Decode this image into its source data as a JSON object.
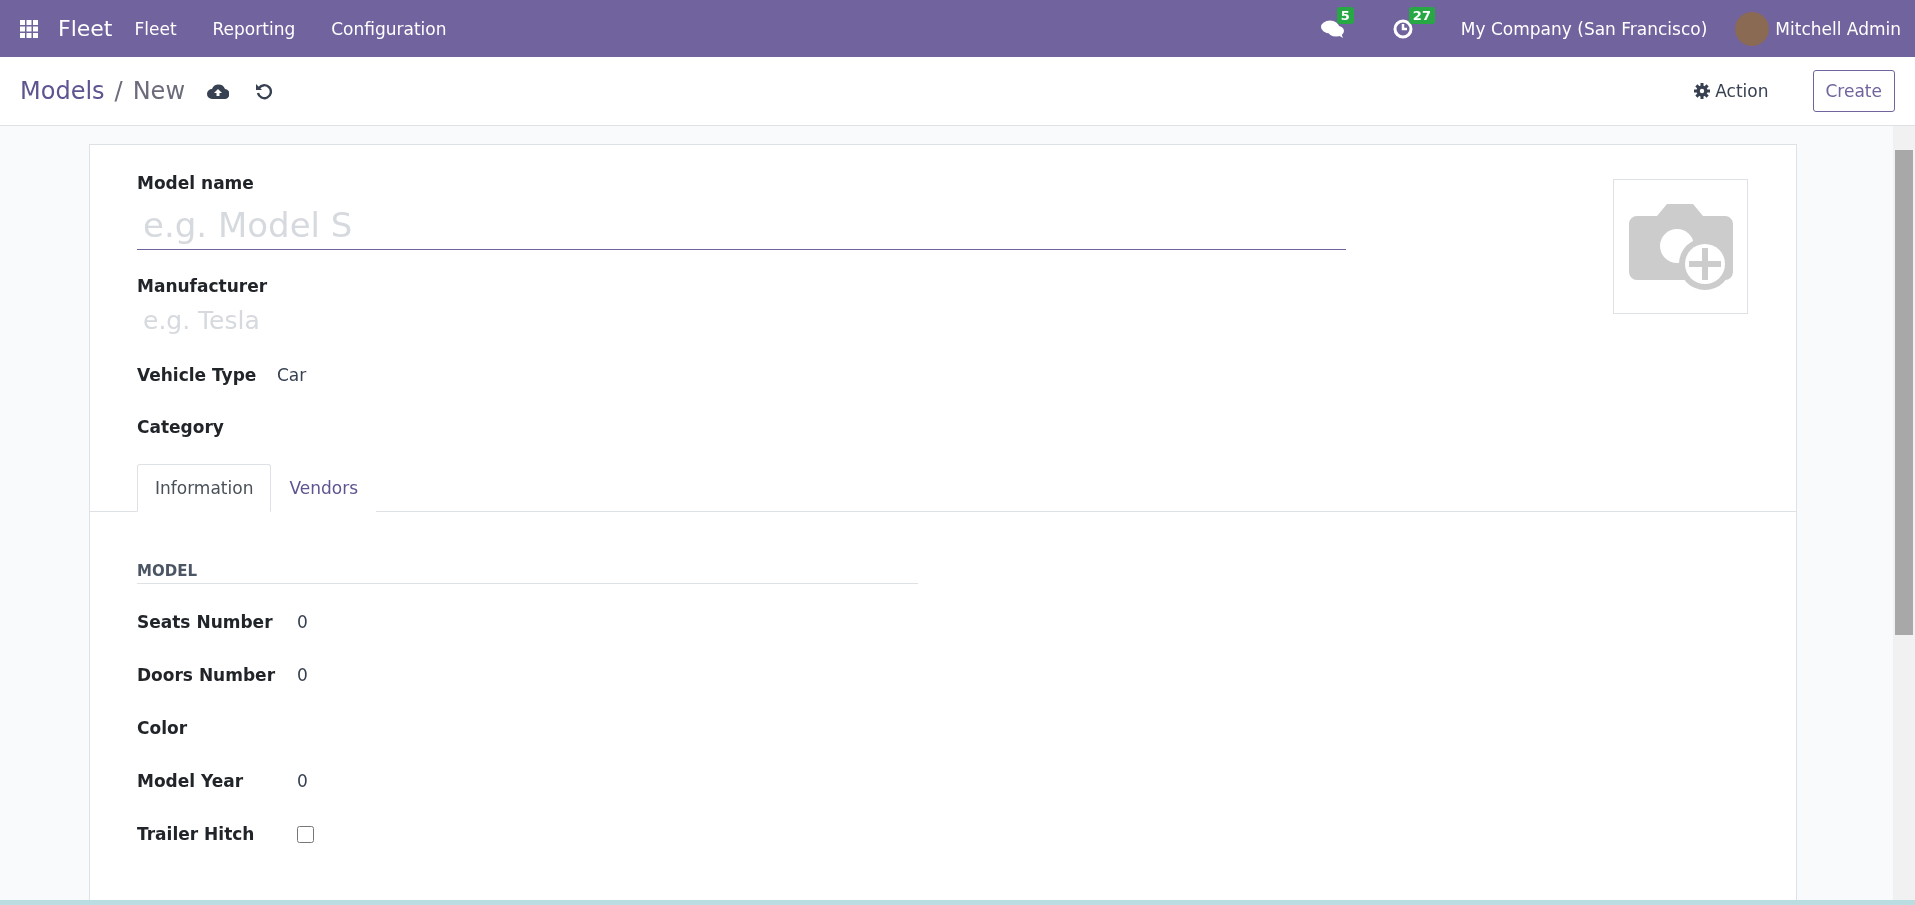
{
  "navbar": {
    "app_name": "Fleet",
    "menu": [
      "Fleet",
      "Reporting",
      "Configuration"
    ],
    "messages_badge": "5",
    "activities_badge": "27",
    "company": "My Company (San Francisco)",
    "user": "Mitchell Admin"
  },
  "control_panel": {
    "breadcrumb": [
      "Models",
      "New"
    ],
    "separator": "/",
    "action": "Action",
    "create": "Create"
  },
  "form": {
    "fields": [
      {
        "kind": "title",
        "label": "Model name",
        "placeholder": "e.g. Model S"
      },
      {
        "kind": "stacked",
        "label": "Manufacturer",
        "placeholder": "e.g. Tesla"
      },
      {
        "kind": "inline",
        "label": "Vehicle Type",
        "value": "Car"
      },
      {
        "kind": "inline",
        "label": "Category"
      }
    ],
    "tabs": [
      {
        "label": "Information",
        "selected": true
      },
      {
        "label": "Vendors",
        "selected": false
      }
    ],
    "section": {
      "title": "MODEL",
      "fields": [
        {
          "kind": "text",
          "label": "Seats Number",
          "value": "0"
        },
        {
          "kind": "text",
          "label": "Doors Number",
          "value": "0"
        },
        {
          "kind": "text",
          "label": "Color"
        },
        {
          "kind": "text",
          "label": "Model Year",
          "value": "0"
        },
        {
          "kind": "checkbox",
          "label": "Trailer Hitch",
          "checked": false
        }
      ]
    }
  }
}
